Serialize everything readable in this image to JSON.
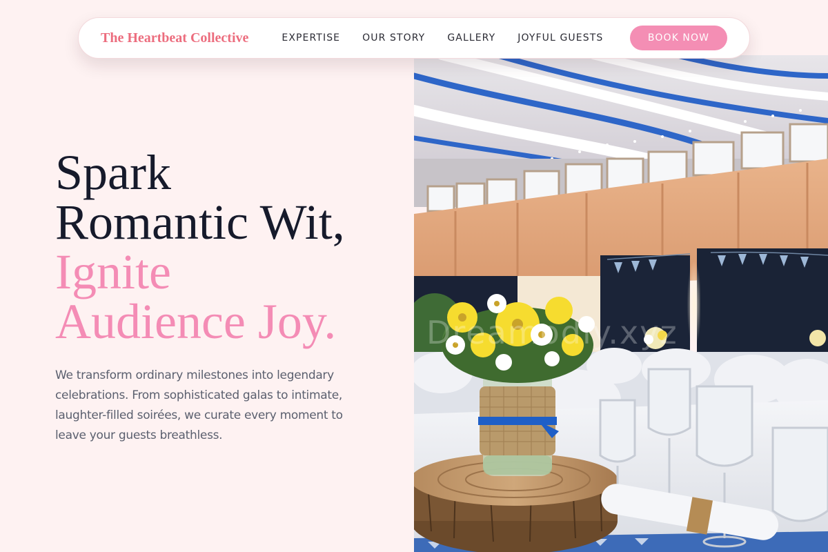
{
  "brand": {
    "name": "The Heartbeat Collective"
  },
  "nav": {
    "links": [
      "EXPERTISE",
      "OUR STORY",
      "GALLERY",
      "JOYFUL GUESTS"
    ],
    "cta": "BOOK NOW"
  },
  "hero": {
    "title_lines": [
      "Spark",
      "Romantic Wit,"
    ],
    "accent_lines": [
      "Ignite",
      "Audience Joy."
    ],
    "description": "We transform ordinary milestones into legendary celebrations. From sophisticated galas to intimate, laughter-filled soirées, we curate every moment to leave your guests breathless.",
    "image_watermark": "Dreamodly.xyz"
  },
  "colors": {
    "page_background": "#fef2f2",
    "brand": "#ec6d7e",
    "accent_pink": "#f48cb5",
    "heading": "#161a2b",
    "body_text": "#5a5f6e"
  }
}
